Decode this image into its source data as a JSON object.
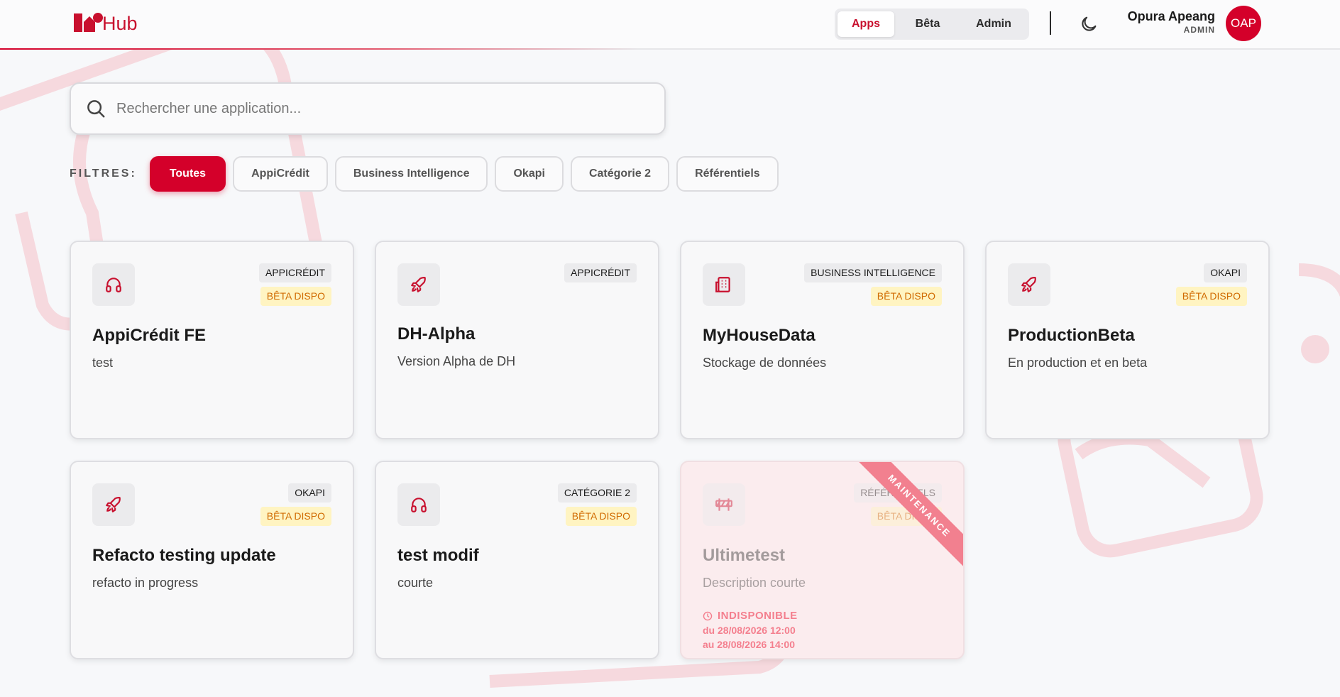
{
  "header": {
    "logo_text": "Hub",
    "nav": [
      {
        "label": "Apps",
        "active": true
      },
      {
        "label": "Bêta",
        "active": false
      },
      {
        "label": "Admin",
        "active": false
      }
    ],
    "theme_toggle_icon": "moon-icon",
    "user": {
      "name": "Opura Apeang",
      "role": "ADMIN",
      "initials": "OAP"
    }
  },
  "search": {
    "placeholder": "Rechercher une application...",
    "value": ""
  },
  "filters": {
    "label": "FILTRES:",
    "chips": [
      "Toutes",
      "AppiCrédit",
      "Business Intelligence",
      "Okapi",
      "Catégorie 2",
      "Référentiels"
    ],
    "active": "Toutes"
  },
  "apps": [
    {
      "title": "AppiCrédit FE",
      "description": "test",
      "category": "APPICRÉDIT",
      "beta": "BÊTA DISPO",
      "icon": "headphones-icon"
    },
    {
      "title": "DH-Alpha",
      "description": "Version Alpha de DH",
      "category": "APPICRÉDIT",
      "beta": null,
      "icon": "rocket-icon"
    },
    {
      "title": "MyHouseData",
      "description": "Stockage de données",
      "category": "BUSINESS INTELLIGENCE",
      "beta": "BÊTA DISPO",
      "icon": "building-icon"
    },
    {
      "title": "ProductionBeta",
      "description": "En production et en beta",
      "category": "OKAPI",
      "beta": "BÊTA DISPO",
      "icon": "rocket-icon"
    },
    {
      "title": "Refacto testing update",
      "description": "refacto in progress",
      "category": "OKAPI",
      "beta": "BÊTA DISPO",
      "icon": "rocket-icon"
    },
    {
      "title": "test modif",
      "description": "courte",
      "category": "CATÉGORIE 2",
      "beta": "BÊTA DISPO",
      "icon": "headphones-icon"
    },
    {
      "title": "Ultimetest",
      "description": "Description courte",
      "category": "RÉFÉRENTIELS",
      "beta": "BÊTA DISPO",
      "icon": "barrier-icon",
      "maintenance": {
        "ribbon": "MAINTENANCE",
        "status": "INDISPONIBLE",
        "from": "du 28/08/2026 12:00",
        "to": "au 28/08/2026 14:00"
      }
    }
  ],
  "colors": {
    "brand": "#d4002a",
    "beta_bg": "#fff4c2",
    "beta_text": "#d06a00",
    "maintenance": "#f2808f"
  }
}
